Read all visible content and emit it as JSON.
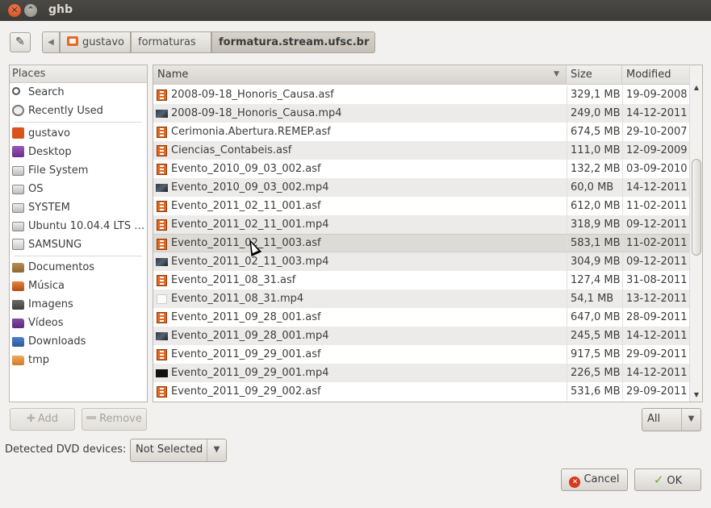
{
  "window": {
    "title": "ghb"
  },
  "pathbar": {
    "crumbs": [
      {
        "label": "gustavo"
      },
      {
        "label": "formaturas"
      },
      {
        "label": "formatura.stream.ufsc.br"
      }
    ]
  },
  "places": {
    "header": "Places",
    "items": [
      {
        "label": "Search",
        "icon": "search-icon"
      },
      {
        "label": "Recently Used",
        "icon": "clock-icon"
      },
      {
        "label": "gustavo",
        "icon": "home-folder-icon"
      },
      {
        "label": "Desktop",
        "icon": "desktop-icon"
      },
      {
        "label": "File System",
        "icon": "drive-icon"
      },
      {
        "label": "OS",
        "icon": "drive-icon"
      },
      {
        "label": "SYSTEM",
        "icon": "drive-icon"
      },
      {
        "label": "Ubuntu 10.04.4 LTS …",
        "icon": "drive-icon"
      },
      {
        "label": "SAMSUNG",
        "icon": "usb-icon"
      },
      {
        "label": "Documentos",
        "icon": "folder-icon"
      },
      {
        "label": "Música",
        "icon": "music-folder-icon"
      },
      {
        "label": "Imagens",
        "icon": "pictures-folder-icon"
      },
      {
        "label": "Vídeos",
        "icon": "videos-folder-icon"
      },
      {
        "label": "Downloads",
        "icon": "downloads-folder-icon"
      },
      {
        "label": "tmp",
        "icon": "folder-icon"
      }
    ]
  },
  "files": {
    "columns": {
      "name": "Name",
      "size": "Size",
      "modified": "Modified"
    },
    "rows": [
      {
        "name": "2008-09-18_Honoris_Causa.asf",
        "size": "329,1 MB",
        "modified": "19-09-2008",
        "icon": "video-file-icon"
      },
      {
        "name": "2008-09-18_Honoris_Causa.mp4",
        "size": "249,0 MB",
        "modified": "14-12-2011",
        "icon": "video-thumbnail-icon"
      },
      {
        "name": "Cerimonia.Abertura.REMEP.asf",
        "size": "674,5 MB",
        "modified": "29-10-2007",
        "icon": "video-file-icon"
      },
      {
        "name": "Ciencias_Contabeis.asf",
        "size": "111,0 MB",
        "modified": "12-09-2009",
        "icon": "video-file-icon"
      },
      {
        "name": "Evento_2010_09_03_002.asf",
        "size": "132,2 MB",
        "modified": "03-09-2010",
        "icon": "video-file-icon"
      },
      {
        "name": "Evento_2010_09_03_002.mp4",
        "size": "60,0 MB",
        "modified": "14-12-2011",
        "icon": "video-thumbnail-icon"
      },
      {
        "name": "Evento_2011_02_11_001.asf",
        "size": "612,0 MB",
        "modified": "11-02-2011",
        "icon": "video-file-icon"
      },
      {
        "name": "Evento_2011_02_11_001.mp4",
        "size": "318,9 MB",
        "modified": "09-12-2011",
        "icon": "video-file-icon"
      },
      {
        "name": "Evento_2011_02_11_003.asf",
        "size": "583,1 MB",
        "modified": "11-02-2011",
        "icon": "video-file-icon",
        "selected": true
      },
      {
        "name": "Evento_2011_02_11_003.mp4",
        "size": "304,9 MB",
        "modified": "09-12-2011",
        "icon": "video-thumbnail-icon"
      },
      {
        "name": "Evento_2011_08_31.asf",
        "size": "127,4 MB",
        "modified": "31-08-2011",
        "icon": "video-file-icon"
      },
      {
        "name": "Evento_2011_08_31.mp4",
        "size": "54,1 MB",
        "modified": "13-12-2011",
        "icon": "blank-thumbnail-icon"
      },
      {
        "name": "Evento_2011_09_28_001.asf",
        "size": "647,0 MB",
        "modified": "28-09-2011",
        "icon": "video-file-icon"
      },
      {
        "name": "Evento_2011_09_28_001.mp4",
        "size": "245,5 MB",
        "modified": "14-12-2011",
        "icon": "video-thumbnail-icon"
      },
      {
        "name": "Evento_2011_09_29_001.asf",
        "size": "917,5 MB",
        "modified": "29-09-2011",
        "icon": "video-file-icon"
      },
      {
        "name": "Evento_2011_09_29_001.mp4",
        "size": "226,5 MB",
        "modified": "14-12-2011",
        "icon": "dark-thumbnail-icon"
      },
      {
        "name": "Evento_2011_09_29_002.asf",
        "size": "531,6 MB",
        "modified": "29-09-2011",
        "icon": "video-file-icon"
      }
    ]
  },
  "buttons": {
    "add": "Add",
    "remove": "Remove",
    "cancel": "Cancel",
    "ok": "OK"
  },
  "filter": {
    "selected": "All"
  },
  "dvd": {
    "label": "Detected DVD devices:",
    "selected": "Not Selected"
  },
  "colors": {
    "titlebar": "#3c3b37",
    "accent_orange": "#e26820",
    "selected_row": "#dddbd6"
  }
}
